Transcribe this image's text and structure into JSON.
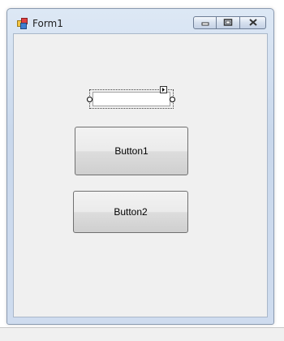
{
  "window": {
    "title": "Form1",
    "icon": "form-icon",
    "controls": [
      "minimize-icon",
      "maximize-icon",
      "close-icon"
    ]
  },
  "form": {
    "textbox": {
      "value": "",
      "selected": true
    },
    "button1": {
      "label": "Button1"
    },
    "button2": {
      "label": "Button2"
    }
  },
  "colors": {
    "client_background": "#f0f0f0",
    "frame": "#c9d8ec"
  }
}
